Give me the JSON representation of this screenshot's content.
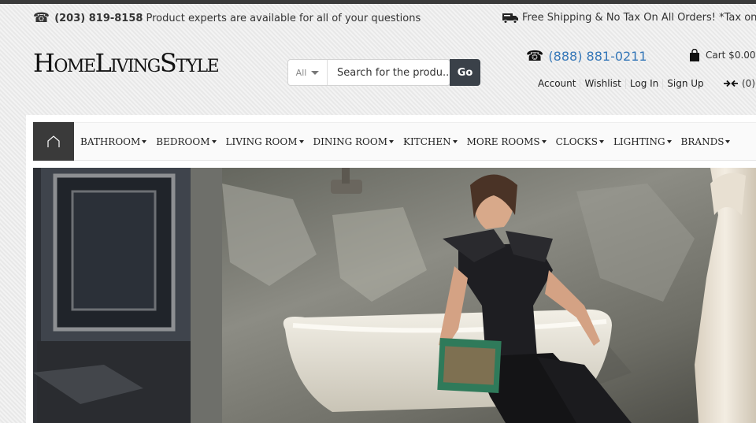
{
  "topbar": {
    "phone": "(203) 819-8158",
    "message": "Product experts are available for all of your questions",
    "shipping": "Free Shipping & No Tax On All Orders! *Tax only in"
  },
  "header": {
    "logo": {
      "p1": "H",
      "p2": "OME",
      "p3": "L",
      "p4": "IVING",
      "p5": "S",
      "p6": "TYLE"
    },
    "search": {
      "category": "All",
      "placeholder": "Search for the produ...",
      "button": "Go"
    },
    "phone": "(888) 881-0211",
    "cart": "Cart $0.00",
    "links": [
      "Account",
      "Wishlist",
      "Log In",
      "Sign Up"
    ],
    "compare_count": "(0)"
  },
  "nav": {
    "items": [
      "BATHROOM",
      "BEDROOM",
      "LIVING ROOM",
      "DINING ROOM",
      "KITCHEN",
      "MORE ROOMS",
      "CLOCKS",
      "LIGHTING",
      "BRANDS"
    ]
  },
  "icons": {
    "phone": "phone-icon",
    "truck": "truck-icon",
    "cart": "shopping-bag-icon",
    "compare": "compare-arrows-icon",
    "home": "home-icon"
  },
  "colors": {
    "accent_blue": "#3577b8",
    "dark": "#3a3a3a",
    "go_button": "#3a4149"
  }
}
